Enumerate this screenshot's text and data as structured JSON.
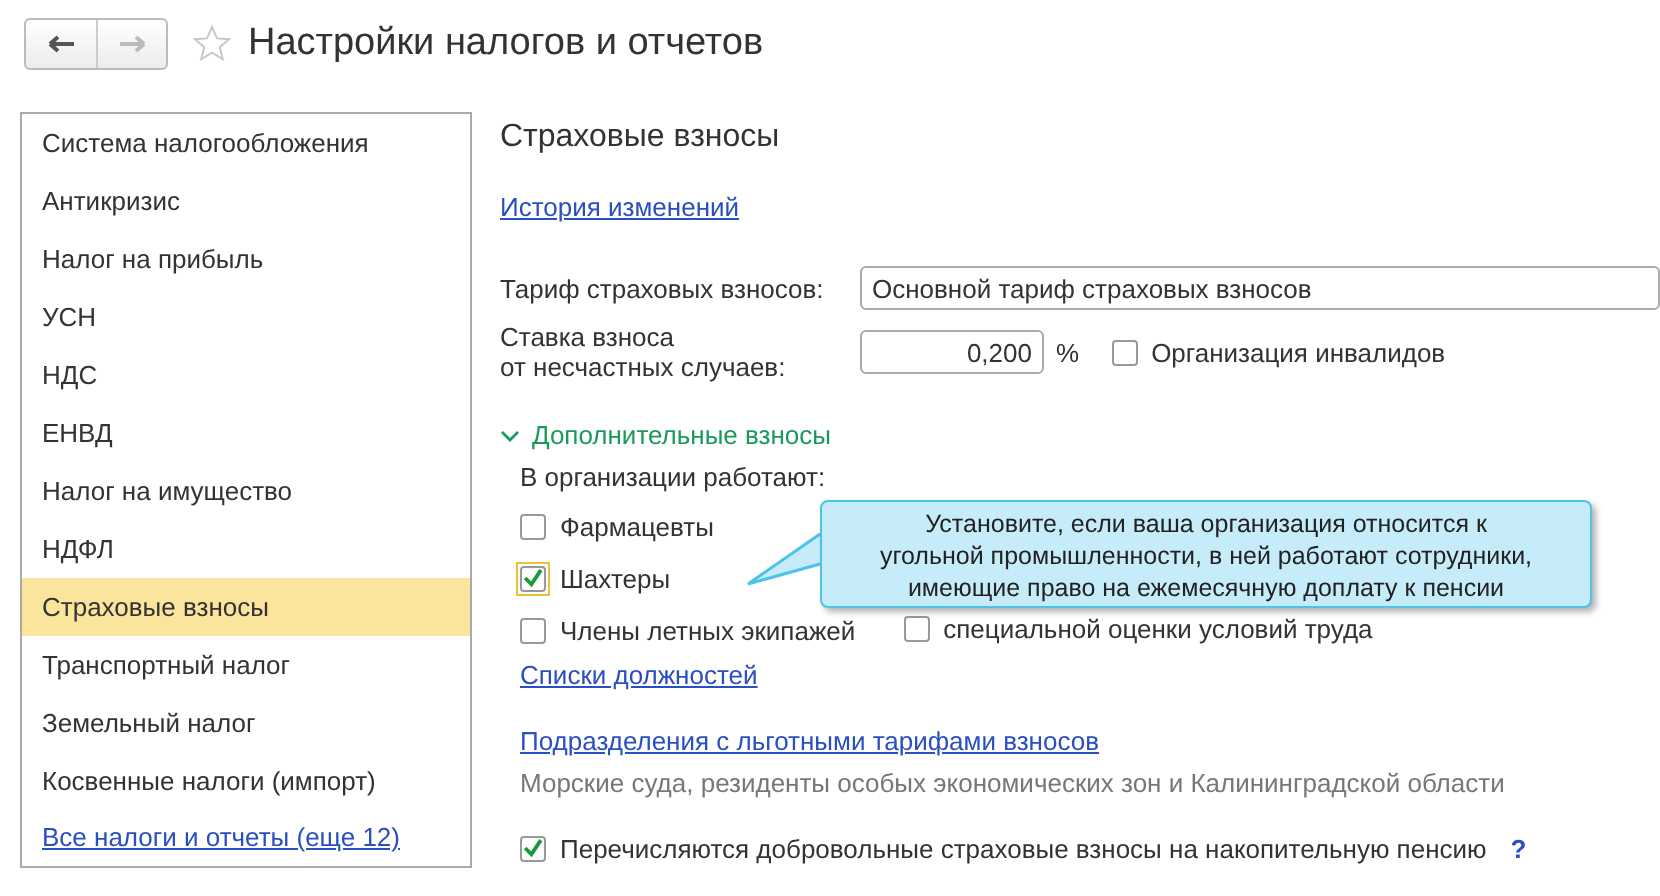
{
  "window": {
    "title": "Настройки налогов и отчетов",
    "back_enabled": true,
    "forward_enabled": false,
    "favorite": false
  },
  "sidebar": {
    "items": [
      {
        "label": "Система налогообложения",
        "selected": false
      },
      {
        "label": "Антикризис",
        "selected": false
      },
      {
        "label": "Налог на прибыль",
        "selected": false
      },
      {
        "label": "УСН",
        "selected": false
      },
      {
        "label": "НДС",
        "selected": false
      },
      {
        "label": "ЕНВД",
        "selected": false
      },
      {
        "label": "Налог на имущество",
        "selected": false
      },
      {
        "label": "НДФЛ",
        "selected": false
      },
      {
        "label": "Страховые взносы",
        "selected": true
      },
      {
        "label": "Транспортный налог",
        "selected": false
      },
      {
        "label": "Земельный налог",
        "selected": false
      },
      {
        "label": "Косвенные налоги (импорт)",
        "selected": false
      }
    ],
    "all_link": "Все налоги и отчеты (еще 12)"
  },
  "content": {
    "heading": "Страховые взносы",
    "history_link": "История изменений",
    "tariff": {
      "label": "Тариф страховых взносов:",
      "value": "Основной тариф страховых взносов"
    },
    "rate": {
      "label_lines": [
        "Ставка взноса",
        "от несчастных случаев:"
      ],
      "value": "0,200",
      "unit": "%"
    },
    "disabled_org": {
      "label": "Организация инвалидов",
      "checked": false
    },
    "extra": {
      "title": "Дополнительные взносы",
      "expanded": true,
      "subtitle": "В организации работают:",
      "workers": [
        {
          "label": "Фармацевты",
          "checked": false,
          "focused": false
        },
        {
          "label": "Шахтеры",
          "checked": true,
          "focused": true
        },
        {
          "label": "Члены летных экипажей",
          "checked": false,
          "focused": false
        }
      ],
      "sout": {
        "label": "специальной оценки условий труда",
        "checked": false
      },
      "positions_link": "Списки должностей"
    },
    "units_link": "Подразделения с льготными тарифами взносов",
    "units_note": "Морские суда, резиденты особых экономических зон и Калининградской области",
    "voluntary": {
      "label": "Перечисляются добровольные страховые взносы на накопительную пенсию",
      "checked": true,
      "help": "?"
    }
  },
  "tooltip": {
    "lines": [
      "Установите, если ваша организация относится к",
      "угольной промышленности, в ней работают сотрудники,",
      "имеющие право на ежемесячную доплату к пенсии"
    ]
  }
}
